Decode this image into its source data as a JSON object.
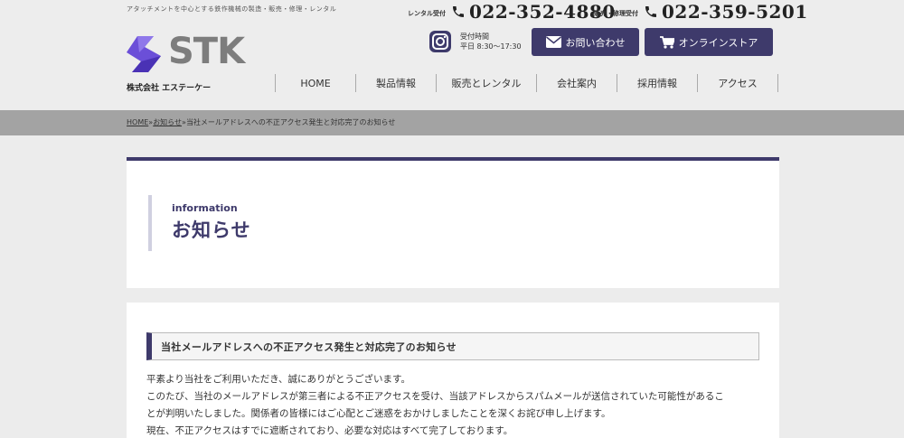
{
  "header": {
    "tagline": "アタッチメントを中心とする鉄作機械の製造・販売・修理・レンタル",
    "phones": [
      {
        "label": "レンタル受付",
        "number": "022-352-4880"
      },
      {
        "label": "販売・修理受付",
        "number": "022-359-5201"
      }
    ],
    "logo_text": "STK",
    "company_name": "株式会社 エステーケー",
    "hours_label": "受付時間",
    "hours_value": "平日 8:30〜17:30",
    "contact_button": "お問い合わせ",
    "store_button": "オンラインストア"
  },
  "nav": {
    "items": [
      {
        "label": "HOME"
      },
      {
        "label": "製品情報"
      },
      {
        "label": "販売とレンタル"
      },
      {
        "label": "会社案内"
      },
      {
        "label": "採用情報"
      },
      {
        "label": "アクセス"
      }
    ]
  },
  "breadcrumb": {
    "home": "HOME",
    "sep": "»",
    "section": "お知らせ",
    "current": "当社メールアドレスへの不正アクセス発生と対応完了のお知らせ"
  },
  "page": {
    "title_en": "information",
    "title_jp": "お知らせ"
  },
  "post": {
    "title": "当社メールアドレスへの不正アクセス発生と対応完了のお知らせ",
    "paragraphs": [
      "平素より当社をご利用いただき、誠にありがとうございます。",
      "このたび、当社のメールアドレスが第三者による不正アクセスを受け、当該アドレスからスパムメールが送信されていた可能性があるこ",
      "とが判明いたしました。関係者の皆様にはご心配とご迷惑をおかけしましたことを深くお詫び申し上げます。",
      "現在、不正アクセスはすでに遮断されており、必要な対応はすべて完了しております。"
    ]
  },
  "colors": {
    "brand": "#3e3a6b",
    "logo_purple": "#6b4fd8",
    "logo_gray": "#7d7d7d",
    "breadcrumb_bar": "#a3a3a3"
  },
  "icons": [
    "phone-icon",
    "instagram-icon",
    "mail-icon",
    "cart-icon",
    "logo-mark-icon"
  ]
}
